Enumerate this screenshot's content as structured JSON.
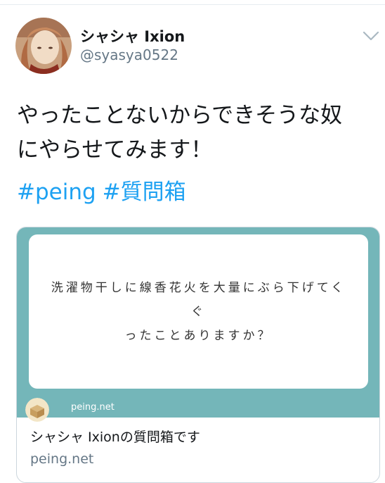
{
  "tweet": {
    "display_name": "シャシャ Ixion",
    "handle": "@syasya0522",
    "text_lines": [
      "やったことないからできそうな奴",
      "にやらせてみます！"
    ],
    "hashtags": [
      "#peing",
      "#質問箱"
    ]
  },
  "card": {
    "question_lines": [
      "洗濯物干しに線香花火を大量にぶら下げてくぐ",
      "ったことありますか？"
    ],
    "watermark": "peing.net",
    "title": "シャシャ Ixionの質問箱です",
    "domain": "peing.net"
  },
  "colors": {
    "link": "#1da1f2",
    "card_bg": "#74b6b9",
    "secondary_text": "#657786"
  },
  "icons": [
    "avatar",
    "chevron-down-icon",
    "peing-logo-icon"
  ]
}
